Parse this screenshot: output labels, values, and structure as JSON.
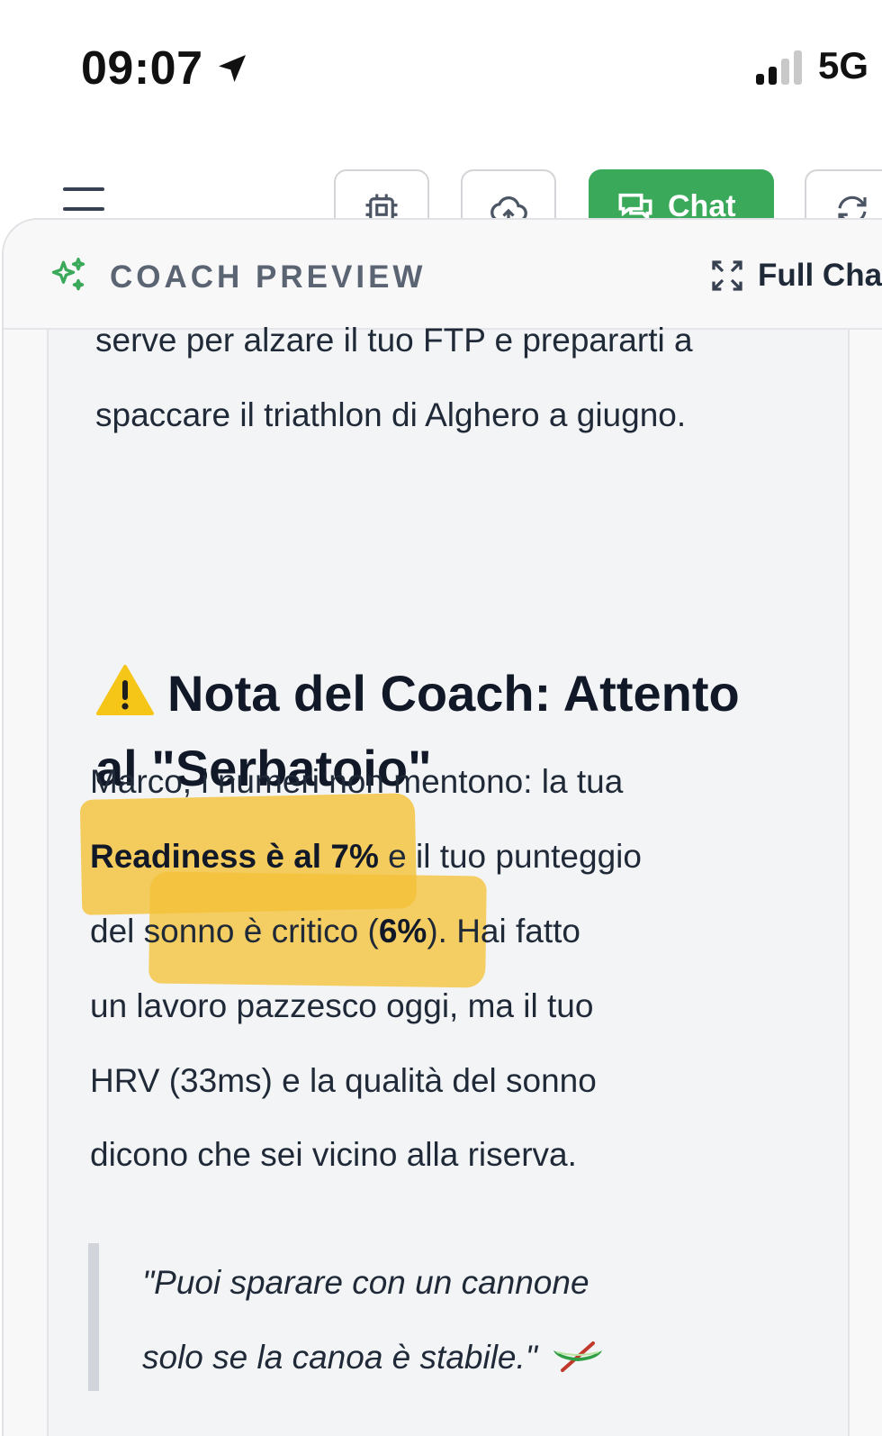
{
  "status": {
    "time": "09:07",
    "network": "5G"
  },
  "toolbar": {
    "chat_label": "Chat"
  },
  "panel": {
    "title": "COACH PREVIEW",
    "full_chat_label": "Full Chat"
  },
  "content": {
    "intro_line1": "serve per alzare il tuo FTP e prepararti a",
    "intro_line2": "spaccare il triathlon di Alghero a giugno.",
    "heading_line1": "Nota del Coach: Attento",
    "heading_line2": "al \"Serbatoio\"",
    "body_line1": "Marco, i numeri non mentono: la tua",
    "body_line2_bold": "Readiness è al 7%",
    "body_line2_rest": " e il tuo punteggio",
    "body_line3_pre": "del sonno è critico (",
    "body_line3_bold": "6%",
    "body_line3_post": "). Hai fatto",
    "body_line4": "un lavoro pazzesco oggi, ma il tuo",
    "body_line5": "HRV (33ms) e la qualità del sonno",
    "body_line6": "dicono che sei vicino alla riserva.",
    "quote_line1": "\"Puoi sparare con un cannone",
    "quote_line2": "solo se la canoa è stabile.\""
  },
  "icons": {
    "location": "location-arrow-icon",
    "menu": "hamburger-menu-icon",
    "chip": "chip-icon",
    "upload": "cloud-upload-icon",
    "chat": "chat-bubbles-icon",
    "refresh": "refresh-icon",
    "sparkle": "sparkle-icon",
    "expand": "expand-icon",
    "warning": "warning-icon",
    "canoe": "canoe-icon"
  },
  "colors": {
    "accent_green": "#3aa95a",
    "highlight": "#f4c23a",
    "warning_yellow": "#f5c518"
  }
}
